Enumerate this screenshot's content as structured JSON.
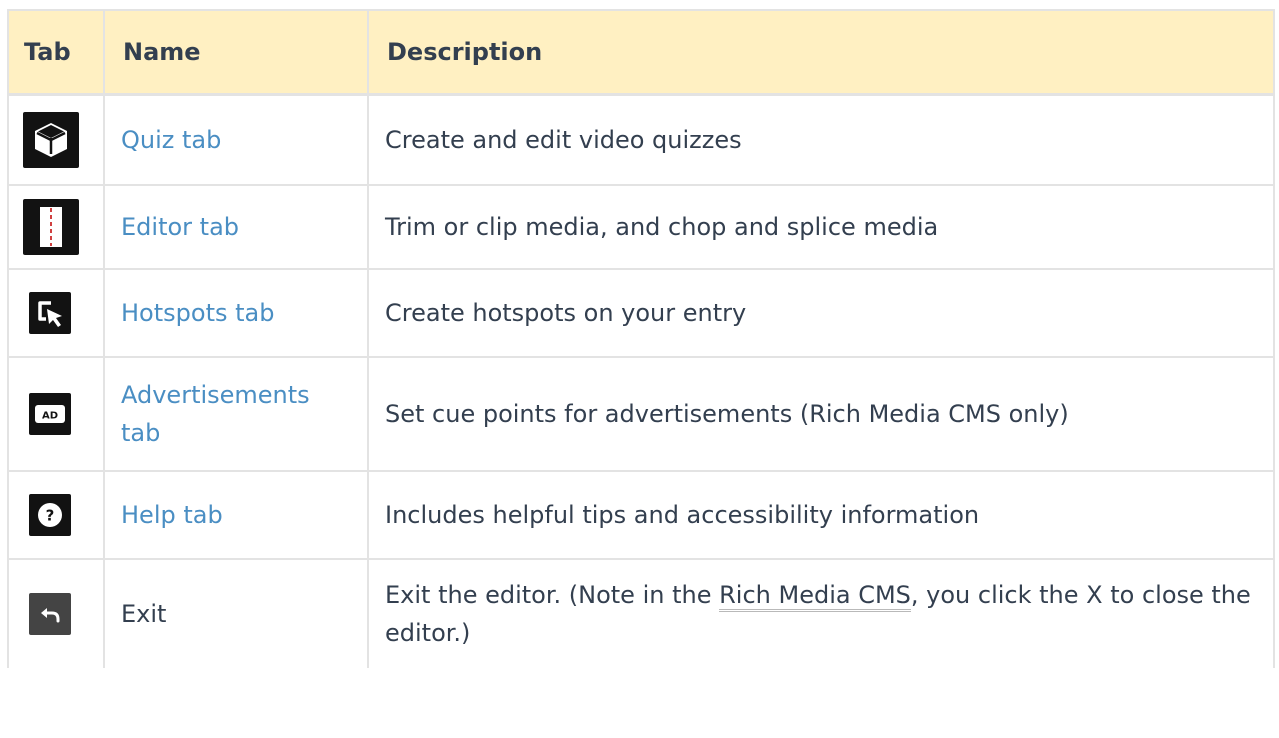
{
  "table": {
    "headers": {
      "tab": "Tab",
      "name": "Name",
      "description": "Description"
    },
    "rows": [
      {
        "icon": "cube-icon",
        "name": "Quiz tab",
        "description": "Create and edit video quizzes"
      },
      {
        "icon": "editor-trim-icon",
        "name": "Editor tab",
        "description": "Trim or clip media, and chop and splice media"
      },
      {
        "icon": "hotspot-cursor-icon",
        "name": "Hotspots tab",
        "description": "Create hotspots on your entry"
      },
      {
        "icon": "ad-badge-icon",
        "name_line1": "Advertisements",
        "name_line2": "tab",
        "description": "Set cue points for advertisements (Rich Media CMS only)"
      },
      {
        "icon": "help-question-icon",
        "name": "Help tab",
        "description": "Includes helpful tips and accessibility information"
      },
      {
        "icon": "exit-arrow-icon",
        "name": "Exit",
        "description_before": "Exit the editor. (Note in the ",
        "description_link": "Rich Media CMS",
        "description_after": ", you click the X to close the editor.)"
      }
    ]
  },
  "colors": {
    "header_bg": "#fff0c2",
    "link": "#4a8ec3",
    "text": "#333f4f",
    "border": "#e3e3e3"
  }
}
